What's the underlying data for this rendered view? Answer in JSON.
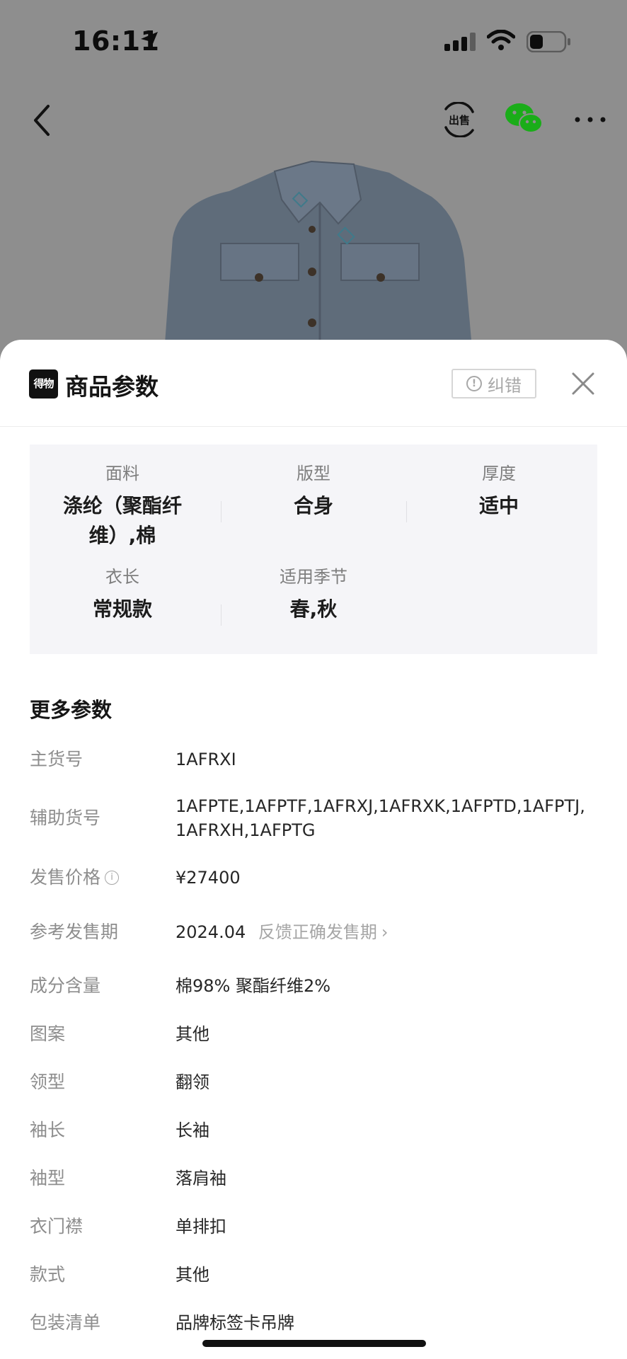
{
  "status_bar": {
    "time": "16:11"
  },
  "nav": {
    "sell_icon_label": "出售"
  },
  "sheet": {
    "brand_logo_text": "得物",
    "title": "商品参数",
    "correct_button_label": "纠错",
    "key_params": [
      {
        "label": "面料",
        "value": "涤纶（聚酯纤维）,棉"
      },
      {
        "label": "版型",
        "value": "合身"
      },
      {
        "label": "厚度",
        "value": "适中"
      },
      {
        "label": "衣长",
        "value": "常规款"
      },
      {
        "label": "适用季节",
        "value": "春,秋"
      }
    ],
    "more_params_title": "更多参数",
    "more_params": [
      {
        "label": "主货号",
        "value": "1AFRXI"
      },
      {
        "label": "辅助货号",
        "value": "1AFPTE,1AFPTF,1AFRXJ,1AFRXK,1AFPTD,1AFPTJ,1AFRXH,1AFPTG"
      },
      {
        "label": "发售价格",
        "value": "¥27400"
      },
      {
        "label": "参考发售期",
        "value": "2024.04",
        "link": "反馈正确发售期"
      },
      {
        "label": "成分含量",
        "value": "棉98% 聚酯纤维2%"
      },
      {
        "label": "图案",
        "value": "其他"
      },
      {
        "label": "领型",
        "value": "翻领"
      },
      {
        "label": "袖长",
        "value": "长袖"
      },
      {
        "label": "袖型",
        "value": "落肩袖"
      },
      {
        "label": "衣门襟",
        "value": "单排扣"
      },
      {
        "label": "款式",
        "value": "其他"
      },
      {
        "label": "包装清单",
        "value": "品牌标签卡吊牌"
      }
    ]
  },
  "colors": {
    "overlay": "#8e8e8e",
    "sheet_bg": "#ffffff",
    "key_params_bg": "#f5f5f8",
    "label_gray": "#8d8d8d",
    "wechat_green": "#1aad19"
  },
  "icons": [
    "location-arrow-icon",
    "cellular-signal-icon",
    "wifi-icon",
    "battery-icon",
    "back-arrow-icon",
    "sell-icon",
    "wechat-icon",
    "more-icon",
    "info-icon",
    "close-icon",
    "chevron-right-icon"
  ]
}
